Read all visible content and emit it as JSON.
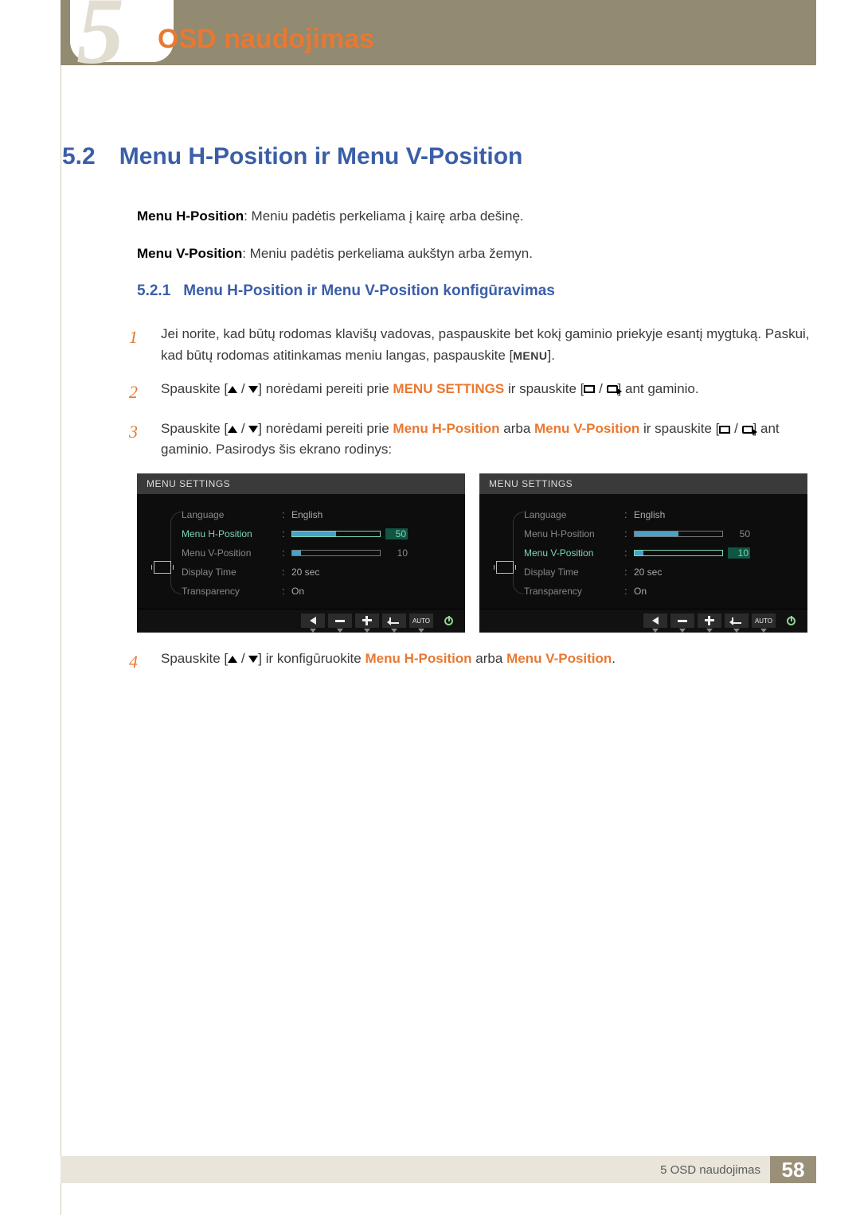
{
  "chapter_number": "5",
  "page_title": "OSD naudojimas",
  "section": {
    "num": "5.2",
    "title": "Menu H-Position ir Menu V-Position"
  },
  "para1": {
    "b": "Menu H-Position",
    "t": ": Meniu padėtis perkeliama į kairę arba dešinę."
  },
  "para2": {
    "b": "Menu V-Position",
    "t": ": Meniu padėtis perkeliama aukštyn arba žemyn."
  },
  "subsection": {
    "num": "5.2.1",
    "title": "Menu H-Position ir Menu V-Position konfigūravimas"
  },
  "steps": {
    "s1": "Jei norite, kad būtų rodomas klavišų vadovas, paspauskite bet kokį gaminio priekyje esantį mygtuką. Paskui, kad būtų rodomas atitinkamas meniu langas, paspauskite [",
    "s1b": "MENU",
    "s1c": "].",
    "s2a": "Spauskite [",
    "s2b": "] norėdami pereiti prie ",
    "s2k": "MENU SETTINGS",
    "s2c": " ir spauskite [",
    "s2d": "] ant gaminio.",
    "s3a": "Spauskite [",
    "s3b": "] norėdami pereiti prie ",
    "s3k1": "Menu H-Position",
    "s3m": " arba ",
    "s3k2": "Menu V-Position",
    "s3c": " ir spauskite [",
    "s3d": "] ant gaminio. Pasirodys šis ekrano rodinys:",
    "s4a": "Spauskite [",
    "s4b": "] ir konfigūruokite ",
    "s4k1": "Menu H-Position",
    "s4m": " arba ",
    "s4k2": "Menu V-Position",
    "s4c": "."
  },
  "osd": {
    "title": "MENU SETTINGS",
    "rows": {
      "language": {
        "label": "Language",
        "value": "English"
      },
      "hpos": {
        "label": "Menu H-Position",
        "value": "50",
        "fill": 50
      },
      "vpos": {
        "label": "Menu V-Position",
        "value": "10",
        "fill": 10
      },
      "dtime": {
        "label": "Display Time",
        "value": "20 sec"
      },
      "transp": {
        "label": "Transparency",
        "value": "On"
      }
    },
    "auto": "AUTO"
  },
  "footer": {
    "text": "5 OSD naudojimas",
    "page": "58"
  }
}
